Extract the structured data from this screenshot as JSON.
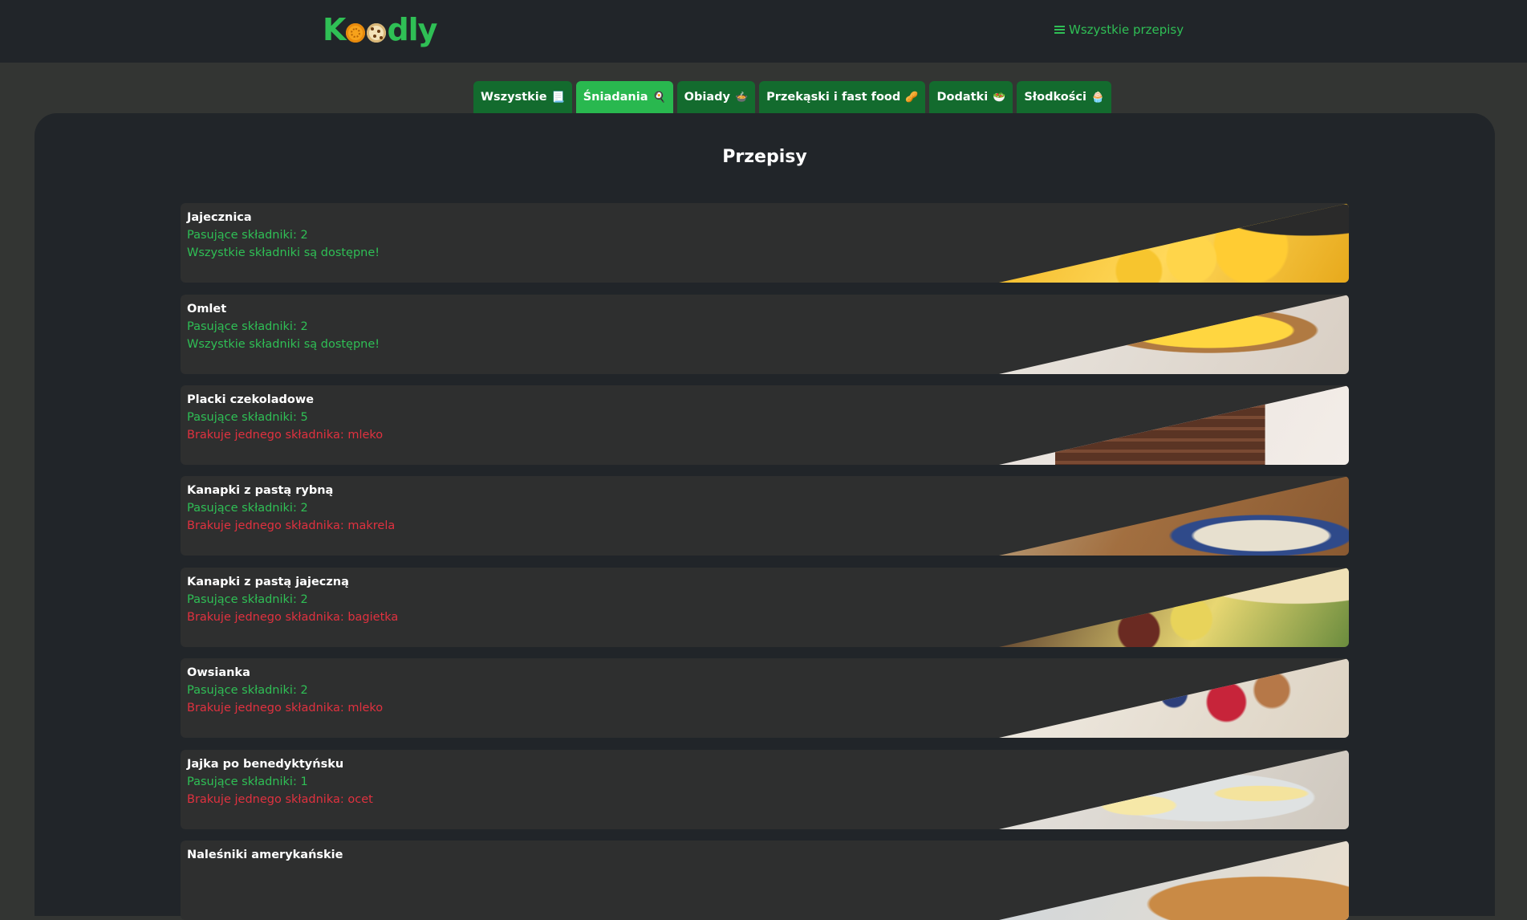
{
  "header": {
    "logo_k": "K",
    "logo_rest": "dly",
    "nav_all_recipes": "Wszystkie przepisy"
  },
  "tabs": [
    {
      "label": "Wszystkie",
      "emoji": "📃",
      "active": false
    },
    {
      "label": "Śniadania",
      "emoji": "🍳",
      "active": true
    },
    {
      "label": "Obiady",
      "emoji": "🍲",
      "active": false
    },
    {
      "label": "Przekąski i fast food",
      "emoji": "🥜",
      "active": false
    },
    {
      "label": "Dodatki",
      "emoji": "🥗",
      "active": false
    },
    {
      "label": "Słodkości",
      "emoji": "🧁",
      "active": false
    }
  ],
  "main": {
    "title": "Przepisy"
  },
  "recipes": [
    {
      "name": "Jajecznica",
      "matching": "Pasujące składniki: 2",
      "status": "Wszystkie składniki są dostępne!",
      "status_type": "ok"
    },
    {
      "name": "Omlet",
      "matching": "Pasujące składniki: 2",
      "status": "Wszystkie składniki są dostępne!",
      "status_type": "ok"
    },
    {
      "name": "Placki czekoladowe",
      "matching": "Pasujące składniki: 5",
      "status": "Brakuje jednego składnika: mleko",
      "status_type": "missing"
    },
    {
      "name": "Kanapki z pastą rybną",
      "matching": "Pasujące składniki: 2",
      "status": "Brakuje jednego składnika: makrela",
      "status_type": "missing"
    },
    {
      "name": "Kanapki z pastą jajeczną",
      "matching": "Pasujące składniki: 2",
      "status": "Brakuje jednego składnika: bagietka",
      "status_type": "missing"
    },
    {
      "name": "Owsianka",
      "matching": "Pasujące składniki: 2",
      "status": "Brakuje jednego składnika: mleko",
      "status_type": "missing"
    },
    {
      "name": "Jajka po benedyktyńsku",
      "matching": "Pasujące składniki: 1",
      "status": "Brakuje jednego składnika: ocet",
      "status_type": "missing"
    },
    {
      "name": "Naleśniki amerykańskie",
      "matching": "",
      "status": "",
      "status_type": "missing"
    }
  ],
  "colors": {
    "accent": "#2fbf55",
    "tab_bg": "#136b2e",
    "tab_active_bg": "#29b84f",
    "missing": "#e0313f",
    "panel_bg": "#212529",
    "card_bg": "#2e2f2f"
  }
}
